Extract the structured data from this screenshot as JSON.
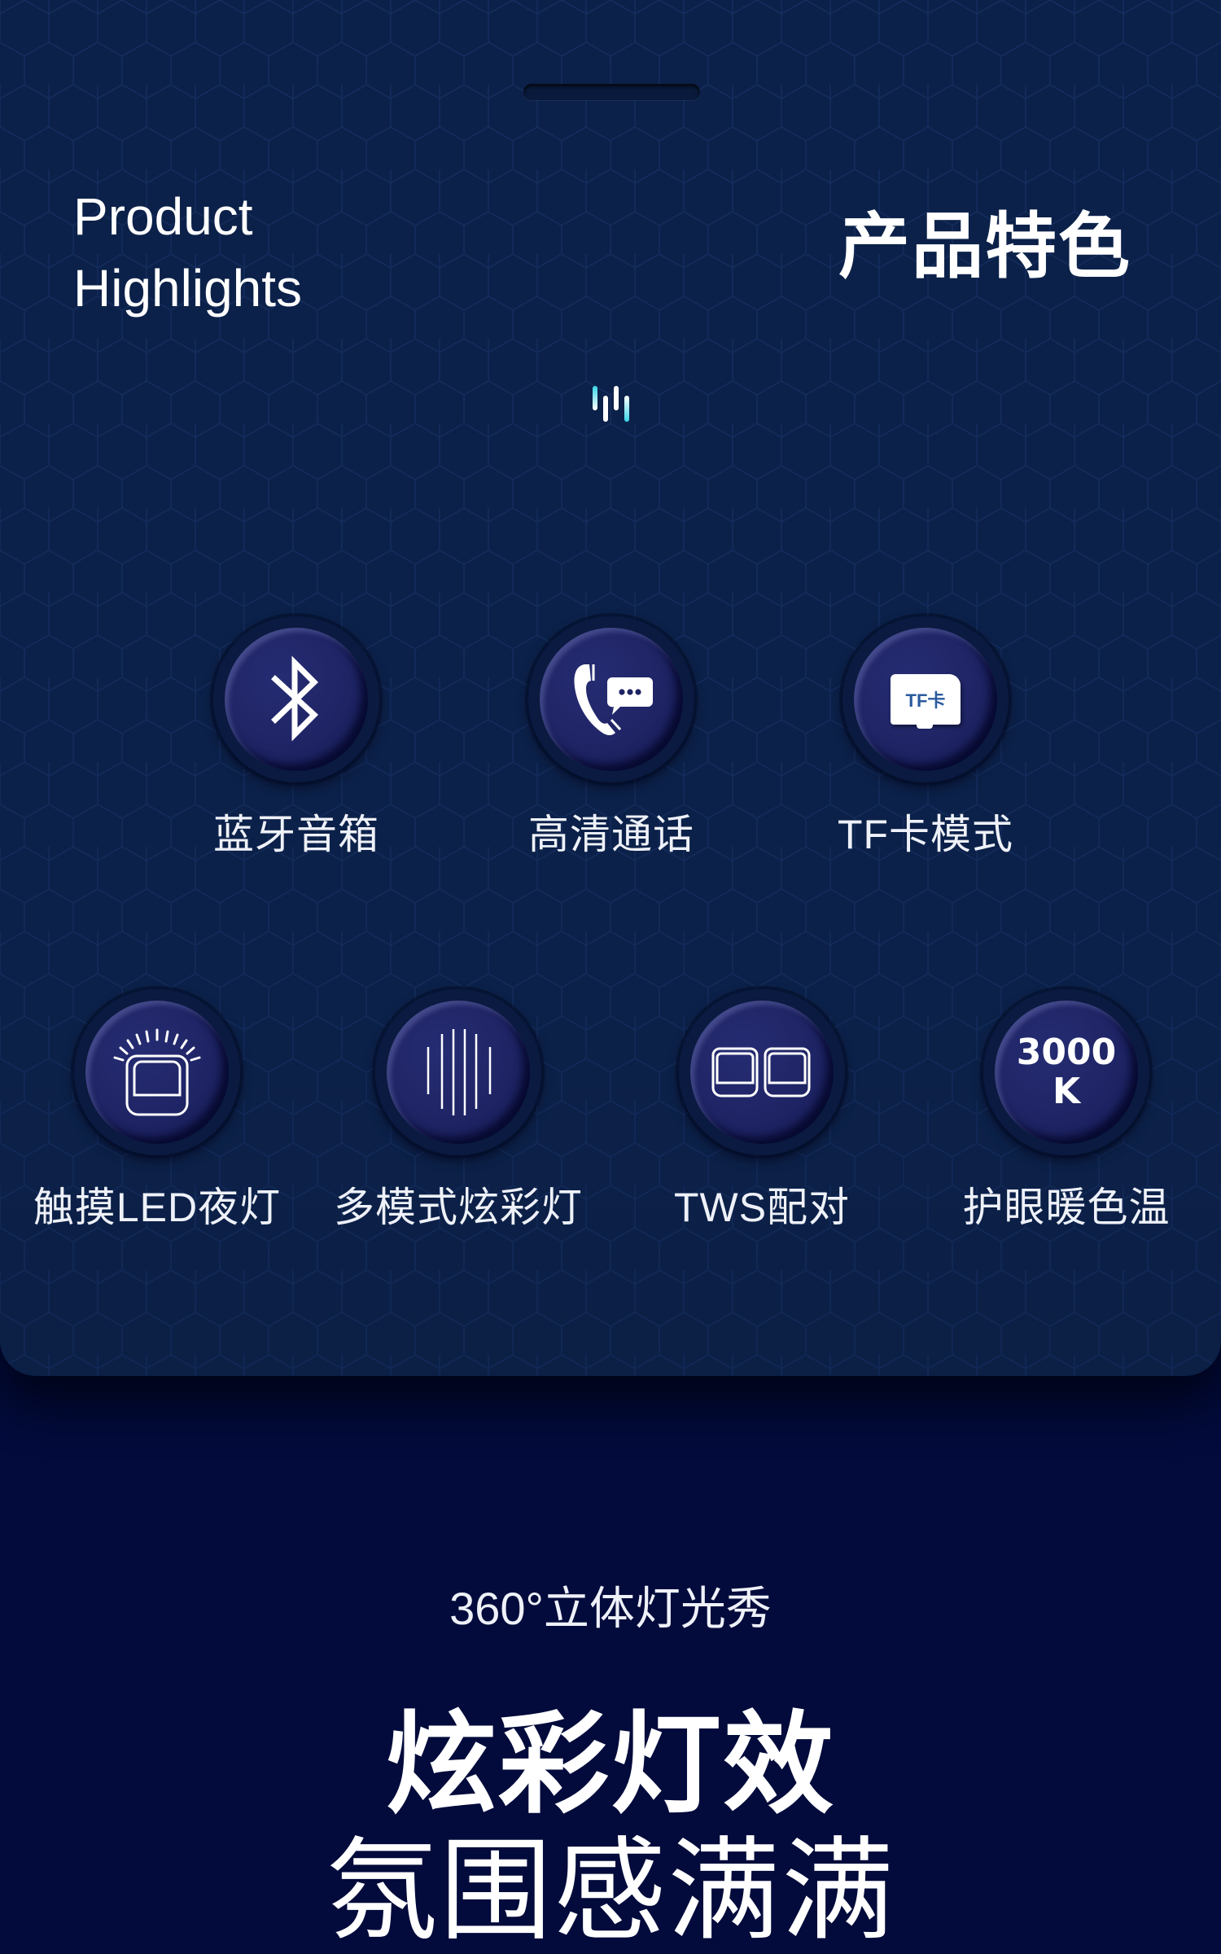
{
  "card": {
    "title_en_line1": "Product",
    "title_en_line2": "Highlights",
    "title_zh": "产品特色",
    "wave_icon": "sound-wave-icon",
    "features_row1": [
      {
        "icon": "bluetooth-icon",
        "label": "蓝牙音箱"
      },
      {
        "icon": "phone-call-message-icon",
        "label": "高清通话"
      },
      {
        "icon": "tf-card-icon",
        "label": "TF卡模式",
        "icon_text": "TF卡"
      }
    ],
    "features_row2": [
      {
        "icon": "night-light-icon",
        "label": "触摸LED夜灯"
      },
      {
        "icon": "light-bars-icon",
        "label": "多模式炫彩灯"
      },
      {
        "icon": "tws-pair-icon",
        "label": "TWS配对"
      },
      {
        "icon": "color-temperature-icon",
        "label": "护眼暖色温",
        "icon_text_line1": "3000",
        "icon_text_line2": "K"
      }
    ]
  },
  "lighting": {
    "subtitle": "360°立体灯光秀",
    "headline": "炫彩灯效",
    "headline2": "氛围感满满"
  },
  "colors": {
    "card_bg": "#0c2149",
    "page_bg": "#020b3b",
    "accent_cyan": "#38d6e8",
    "button_face": "#1e2464",
    "text": "#ffffff"
  }
}
